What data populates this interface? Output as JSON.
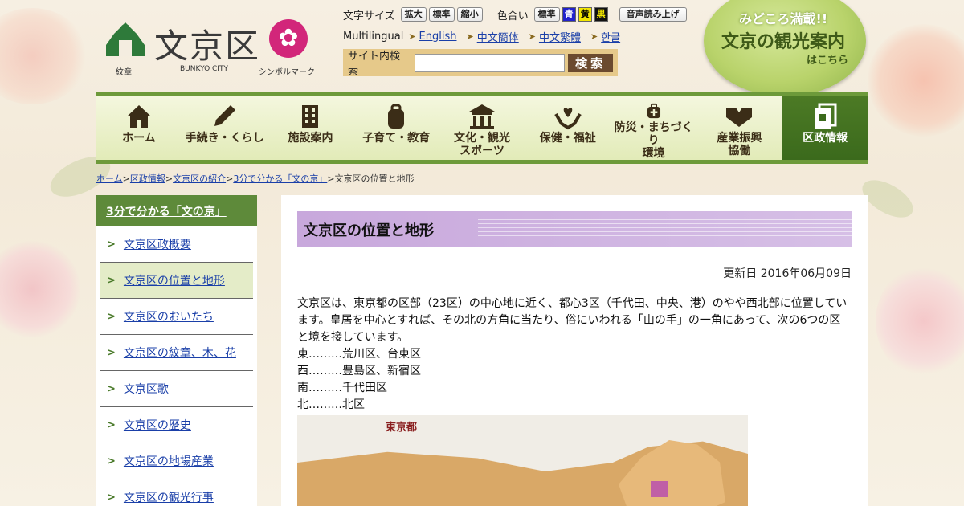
{
  "header": {
    "emblem_label": "紋章",
    "city_name": "文京区",
    "city_name_en": "BUNKYO CITY",
    "symbol_label": "シンボルマーク"
  },
  "tools": {
    "font_size_label": "文字サイズ",
    "font_buttons": [
      "拡大",
      "標準",
      "縮小"
    ],
    "color_label": "色合い",
    "color_buttons": [
      "標準",
      "青",
      "黄",
      "黒"
    ],
    "speech_button": "音声読み上げ"
  },
  "multilingual": {
    "label": "Multilingual",
    "links": [
      "English",
      "中文簡体",
      "中文繁體",
      "한글"
    ]
  },
  "search": {
    "label": "サイト内検索",
    "button": "検索",
    "placeholder": ""
  },
  "tour_banner": {
    "line1": "みどころ満載!!",
    "line2": "文京の観光案内",
    "line3": "はこちら"
  },
  "nav": [
    {
      "label": "ホーム",
      "icon": "home-icon"
    },
    {
      "label": "手続き・くらし",
      "icon": "pencil-icon"
    },
    {
      "label": "施設案内",
      "icon": "building-icon"
    },
    {
      "label": "子育て・教育",
      "icon": "backpack-icon"
    },
    {
      "label": "文化・観光スポーツ",
      "label_l1": "文化・観光",
      "label_l2": "スポーツ",
      "icon": "temple-icon"
    },
    {
      "label": "保健・福祉",
      "icon": "hands-heart-icon"
    },
    {
      "label": "防災・まちづくり環境",
      "label_l1": "防災・まちづくり",
      "label_l2": "環境",
      "icon": "kit-icon"
    },
    {
      "label": "産業振興協働",
      "label_l1": "産業振興",
      "label_l2": "協働",
      "icon": "handshake-icon"
    },
    {
      "label": "区政情報",
      "icon": "document-icon"
    }
  ],
  "breadcrumb": {
    "items": [
      "ホーム",
      "区政情報",
      "文京区の紹介",
      "3分で分かる「文の京」"
    ],
    "current": "文京区の位置と地形"
  },
  "sidebar": {
    "heading": "3分で分かる「文の京」",
    "items": [
      "文京区政概要",
      "文京区の位置と地形",
      "文京区のおいたち",
      "文京区の紋章、木、花",
      "文京区歌",
      "文京区の歴史",
      "文京区の地場産業",
      "文京区の観光行事"
    ],
    "active_index": 1
  },
  "article": {
    "title": "文京区の位置と地形",
    "updated": "更新日 2016年06月09日",
    "paragraph": "文京区は、東京都の区部（23区）の中心地に近く、都心3区（千代田、中央、港）のやや西北部に位置しています。皇居を中心とすれば、その北の方角に当たり、俗にいわれる「山の手」の一角にあって、次の6つの区と境を接しています。",
    "borders": [
      "東………荒川区、台東区",
      "西………豊島区、新宿区",
      "南………千代田区",
      "北………北区"
    ],
    "map_label": "東京都"
  },
  "colors": {
    "nav_green": "#6d9a3a",
    "nav_active": "#3b6a1c",
    "sidebar_head": "#5e8a3a",
    "title_purple": "#c8a8dc",
    "search_bg": "#e6c98a",
    "symbol_magenta": "#d2267a"
  }
}
